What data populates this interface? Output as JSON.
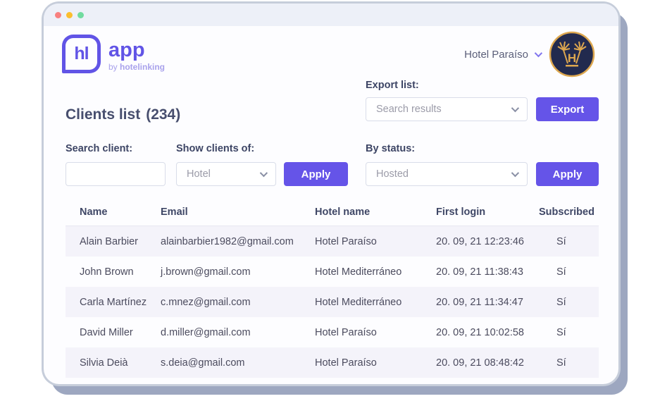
{
  "colors": {
    "accent_purple": "#6154e6",
    "button_purple": "#6554e8",
    "brand_light_purple": "#a9a2ec",
    "titlebar_bg": "#edf0f8",
    "dot_red": "#f8807f",
    "dot_yellow": "#fbbe2e",
    "dot_green": "#71db9f",
    "row_stripe": "#f4f3fa",
    "avatar_navy": "#222a4e",
    "avatar_gold": "#dda74f",
    "frame_shadow": "#9da7c0"
  },
  "brand": {
    "mark": "hl",
    "app_name": "app",
    "byline_prefix": "by ",
    "byline_brand": "hotelinking"
  },
  "account": {
    "hotel_name": "Hotel Paraíso",
    "avatar_initial": "H"
  },
  "export": {
    "label": "Export list:",
    "selected_option": "Search results",
    "button_label": "Export"
  },
  "page": {
    "title": "Clients list",
    "count": "(234)"
  },
  "filters": {
    "search": {
      "label": "Search client:",
      "value": ""
    },
    "show_clients": {
      "label": "Show clients of:",
      "selected_option": "Hotel",
      "apply_label": "Apply"
    },
    "status": {
      "label": "By status:",
      "selected_option": "Hosted",
      "apply_label": "Apply"
    }
  },
  "table": {
    "columns": [
      "Name",
      "Email",
      "Hotel name",
      "First login",
      "Subscribed"
    ],
    "rows": [
      [
        "Alain Barbier",
        "alainbarbier1982@gmail.com",
        "Hotel Paraíso",
        "20. 09, 21 12:23:46",
        "Sí"
      ],
      [
        "John Brown",
        "j.brown@gmail.com",
        "Hotel Mediterráneo",
        "20. 09, 21 11:38:43",
        "Sí"
      ],
      [
        "Carla Martínez",
        "c.mnez@gmail.com",
        "Hotel Mediterráneo",
        "20. 09, 21 11:34:47",
        "Sí"
      ],
      [
        "David Miller",
        "d.miller@gmail.com",
        "Hotel Paraíso",
        "20. 09, 21 10:02:58",
        "Sí"
      ],
      [
        "Silvia Deià",
        "s.deia@gmail.com",
        "Hotel Paraíso",
        "20. 09, 21 08:48:42",
        "Sí"
      ]
    ]
  }
}
